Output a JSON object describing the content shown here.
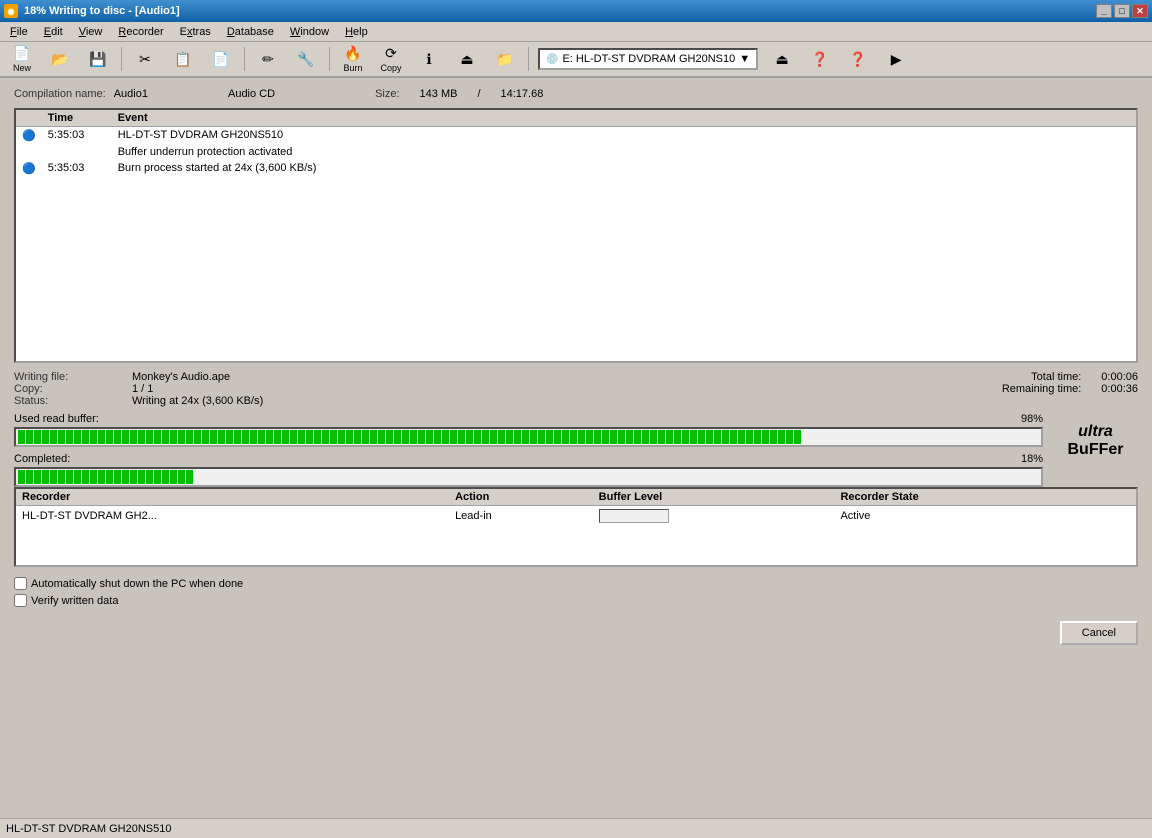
{
  "titleBar": {
    "text": "18% Writing to disc - [Audio1]",
    "buttons": [
      "_",
      "□",
      "✕"
    ]
  },
  "menuBar": {
    "items": [
      {
        "label": "File",
        "underline": "F"
      },
      {
        "label": "Edit",
        "underline": "E"
      },
      {
        "label": "View",
        "underline": "V"
      },
      {
        "label": "Recorder",
        "underline": "R"
      },
      {
        "label": "Extras",
        "underline": "x"
      },
      {
        "label": "Database",
        "underline": "D"
      },
      {
        "label": "Window",
        "underline": "W"
      },
      {
        "label": "Help",
        "underline": "H"
      }
    ]
  },
  "toolbar": {
    "newLabel": "New",
    "driveSelector": "E: HL-DT-ST DVDRAM GH20NS10"
  },
  "compilation": {
    "nameLabel": "Compilation name:",
    "nameValue": "Audio1",
    "typeLabel": "",
    "typeValue": "Audio CD",
    "sizeLabel": "Size:",
    "sizeValue": "143 MB",
    "separator": "/",
    "duration": "14:17.68"
  },
  "logTable": {
    "headers": [
      "",
      "Time",
      "Event"
    ],
    "rows": [
      {
        "icon": "info",
        "time": "5:35:03",
        "event": "HL-DT-ST DVDRAM GH20NS510",
        "subEvent": ""
      },
      {
        "icon": "",
        "time": "",
        "event": "Buffer underrun protection activated",
        "subEvent": ""
      },
      {
        "icon": "info",
        "time": "5:35:03",
        "event": "Burn process started at 24x (3,600 KB/s)",
        "subEvent": ""
      }
    ]
  },
  "writingInfo": {
    "fileLabel": "Writing file:",
    "fileValue": "Monkey's Audio.ape",
    "copyLabel": "Copy:",
    "copyValue": "1 / 1",
    "statusLabel": "Status:",
    "statusValue": "Writing at 24x (3,600 KB/s)",
    "totalTimeLabel": "Total time:",
    "totalTimeValue": "0:00:06",
    "remainingTimeLabel": "Remaining time:",
    "remainingTimeValue": "0:00:36"
  },
  "readBuffer": {
    "label": "Used read buffer:",
    "percent": "98%",
    "segments": 98
  },
  "completed": {
    "label": "Completed:",
    "percent": "18%",
    "segments": 18
  },
  "recorderTable": {
    "headers": [
      "Recorder",
      "Action",
      "Buffer Level",
      "Recorder State",
      ""
    ],
    "rows": [
      {
        "recorder": "HL-DT-ST DVDRAM GH2...",
        "action": "Lead-in",
        "bufferLevel": 0,
        "state": "Active"
      }
    ]
  },
  "checkboxes": {
    "shutdown": {
      "label": "Automatically shut down the PC when done",
      "checked": false
    },
    "verify": {
      "label": "Verify written data",
      "checked": false
    }
  },
  "buttons": {
    "cancel": "Cancel"
  },
  "statusBar": {
    "text": "HL-DT-ST DVDRAM GH20NS510"
  },
  "ultrabuffer": {
    "line1": "ultra",
    "line2": "BuFFer"
  }
}
